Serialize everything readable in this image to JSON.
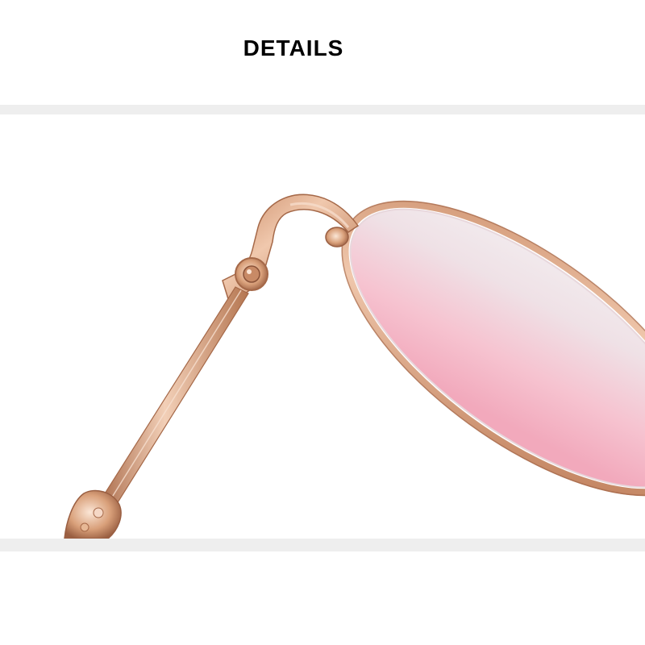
{
  "header": {
    "title": "DETAILS"
  },
  "photo": {
    "subject": "sunglasses-temple-hinge",
    "colors": {
      "frame_gold": "#d9a07a",
      "frame_highlight": "#f3d4bd",
      "frame_shadow": "#a56848",
      "lens_light": "#f1e6ea",
      "lens_pink": "#f4b3c4",
      "band": "#eeeeee"
    }
  }
}
